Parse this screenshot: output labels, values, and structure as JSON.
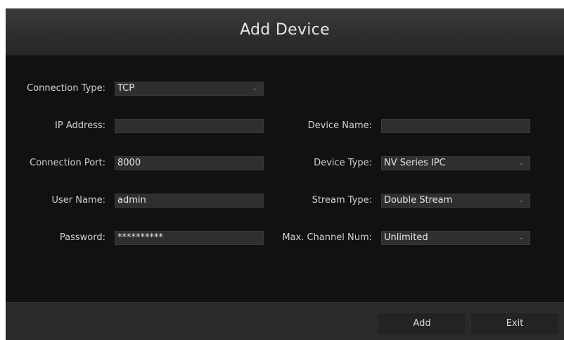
{
  "dialog": {
    "title": "Add Device"
  },
  "form": {
    "connection_type": {
      "label": "Connection Type:",
      "value": "TCP"
    },
    "ip_address": {
      "label": "IP Address:",
      "value": ""
    },
    "connection_port": {
      "label": "Connection Port:",
      "value": "8000"
    },
    "user_name": {
      "label": "User Name:",
      "value": "admin"
    },
    "password": {
      "label": "Password:",
      "value": "**********"
    },
    "device_name": {
      "label": "Device Name:",
      "value": ""
    },
    "device_type": {
      "label": "Device Type:",
      "value": "NV Series IPC"
    },
    "stream_type": {
      "label": "Stream Type:",
      "value": "Double Stream"
    },
    "max_channel_num": {
      "label": "Max. Channel Num:",
      "value": "Unlimited"
    }
  },
  "footer": {
    "add_label": "Add",
    "exit_label": "Exit"
  },
  "icons": {
    "dropdown": "chevron-down-icon"
  },
  "colors": {
    "background": "#111111",
    "field": "#2f2f2f",
    "text": "#d2d2d2"
  }
}
